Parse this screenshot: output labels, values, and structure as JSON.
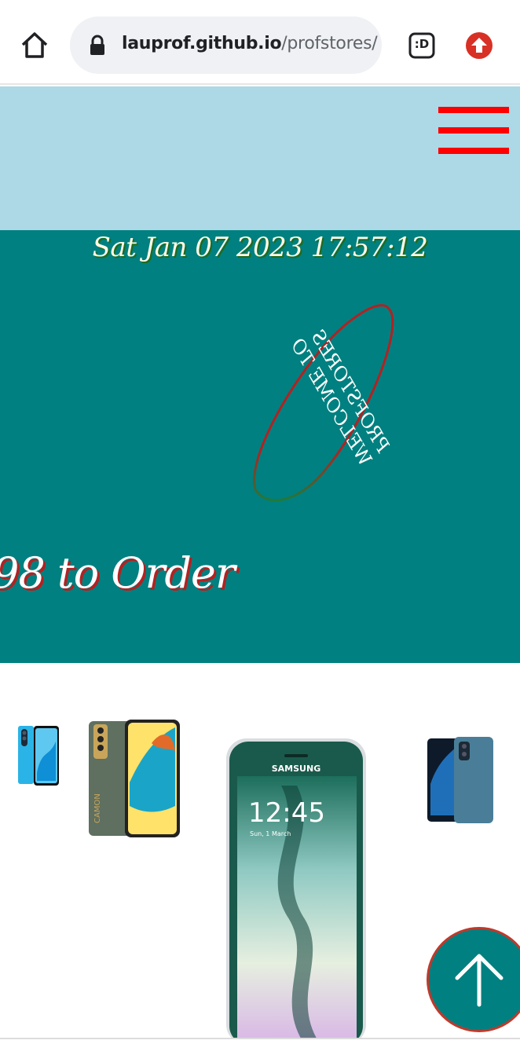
{
  "browser": {
    "url_host": "lauprof.github.io",
    "url_path": "/profstores/",
    "icons": [
      "home-icon",
      "lock-icon",
      "extension-icon",
      "update-icon"
    ],
    "extension_label": ":D"
  },
  "header": {
    "menu_icon": "hamburger-icon",
    "background": "#add8e6",
    "menu_color": "#ff0000"
  },
  "hero": {
    "datetime": "Sat Jan 07 2023 17:57:12",
    "welcome_line1": "WELCOME TO",
    "welcome_line2": "PROFSTORES",
    "marquee": "98 to Order",
    "background": "#008080"
  },
  "products": {
    "images": [
      "phone-blue-small",
      "tecno-camon-phone",
      "samsung-galaxy-edge",
      "phone-dark-blue"
    ],
    "samsung_brand": "SAMSUNG",
    "samsung_time": "12:45",
    "samsung_date": "Sun, 1 March",
    "camon_label": "CAMON"
  },
  "scroll_top": {
    "icon": "arrow-up-icon",
    "color": "#008080"
  }
}
